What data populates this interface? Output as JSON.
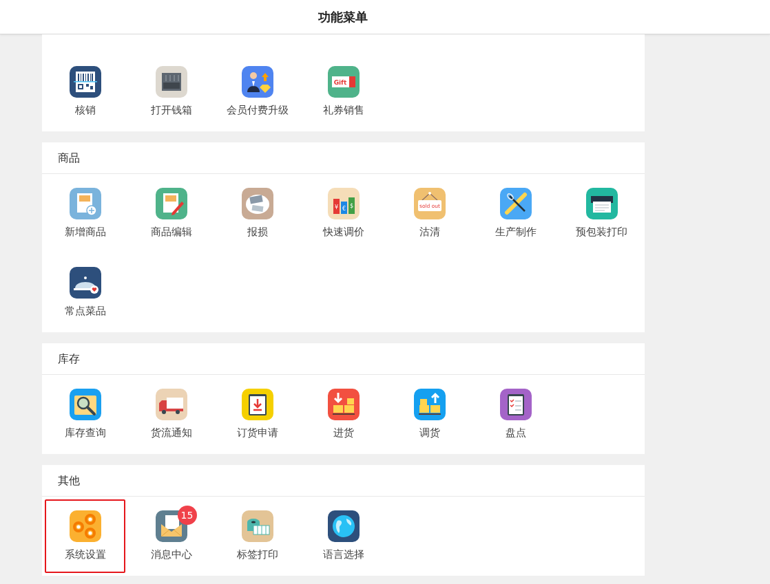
{
  "header": {
    "title": "功能菜单"
  },
  "sections": [
    {
      "items": [
        {
          "label": "核销",
          "selected": false
        },
        {
          "label": "打开钱箱",
          "selected": false
        },
        {
          "label": "会员付费升级",
          "selected": false
        },
        {
          "label": "礼券销售",
          "selected": false,
          "icon_text": "Gift"
        }
      ]
    },
    {
      "title": "商品",
      "items": [
        {
          "label": "新增商品",
          "selected": false
        },
        {
          "label": "商品编辑",
          "selected": false
        },
        {
          "label": "报损",
          "selected": false
        },
        {
          "label": "快速调价",
          "selected": false,
          "icon_texts": [
            "¥",
            "€",
            "$"
          ]
        },
        {
          "label": "沽清",
          "selected": false,
          "icon_text": "sold out"
        },
        {
          "label": "生产制作",
          "selected": false
        },
        {
          "label": "预包装打印",
          "selected": false
        },
        {
          "label": "常点菜品",
          "selected": false
        }
      ]
    },
    {
      "title": "库存",
      "items": [
        {
          "label": "库存查询",
          "selected": false
        },
        {
          "label": "货流通知",
          "selected": false
        },
        {
          "label": "订货申请",
          "selected": false
        },
        {
          "label": "进货",
          "selected": false
        },
        {
          "label": "调货",
          "selected": false
        },
        {
          "label": "盘点",
          "selected": false
        }
      ]
    },
    {
      "title": "其他",
      "items": [
        {
          "label": "系统设置",
          "selected": true
        },
        {
          "label": "消息中心",
          "selected": false,
          "badge": "15"
        },
        {
          "label": "标签打印",
          "selected": false
        },
        {
          "label": "语言选择",
          "selected": false
        }
      ]
    }
  ]
}
